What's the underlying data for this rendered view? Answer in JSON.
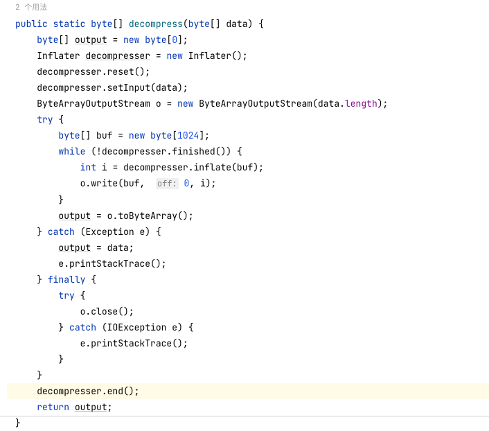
{
  "usages": "2 个用法",
  "code": {
    "l1": {
      "kw1": "public",
      "kw2": "static",
      "type": "byte",
      "brackets1": "[]",
      "method": "decompress",
      "ptype": "byte",
      "brackets2": "[]",
      "param": "data"
    },
    "l2": {
      "type": "byte",
      "brackets": "[]",
      "var": "output",
      "kw": "new",
      "ntype": "byte",
      "num": "0"
    },
    "l3": {
      "type": "Inflater",
      "var": "decompresser",
      "kw": "new",
      "ctor": "Inflater"
    },
    "l4": {
      "obj": "decompresser",
      "call": "reset"
    },
    "l5": {
      "obj": "decompresser",
      "call": "setInput",
      "arg": "data"
    },
    "l6": {
      "type": "ByteArrayOutputStream",
      "var": "o",
      "kw": "new",
      "ctor": "ByteArrayOutputStream",
      "arg": "data",
      "field": "length"
    },
    "l7": {
      "kw": "try"
    },
    "l8": {
      "type": "byte",
      "brackets": "[]",
      "var": "buf",
      "kw": "new",
      "ntype": "byte",
      "num": "1024"
    },
    "l9": {
      "kw": "while",
      "obj": "decompresser",
      "call": "finished"
    },
    "l10": {
      "type": "int",
      "var": "i",
      "obj": "decompresser",
      "call": "inflate",
      "arg": "buf"
    },
    "l11": {
      "obj": "o",
      "call": "write",
      "arg1": "buf",
      "hint": "off:",
      "num": "0",
      "arg2": "i"
    },
    "l12": {
      "var": "output",
      "obj": "o",
      "call": "toByteArray"
    },
    "l13": {
      "kw": "catch",
      "type": "Exception",
      "var": "e"
    },
    "l14": {
      "var": "output",
      "rhs": "data"
    },
    "l15": {
      "obj": "e",
      "call": "printStackTrace"
    },
    "l16": {
      "kw": "finally"
    },
    "l17": {
      "kw": "try"
    },
    "l18": {
      "obj": "o",
      "call": "close"
    },
    "l19": {
      "kw": "catch",
      "type": "IOException",
      "var": "e"
    },
    "l20": {
      "obj": "e",
      "call": "printStackTrace"
    },
    "l21": {
      "obj": "decompresser",
      "call": "end"
    },
    "l22": {
      "kw": "return",
      "var": "output"
    }
  }
}
